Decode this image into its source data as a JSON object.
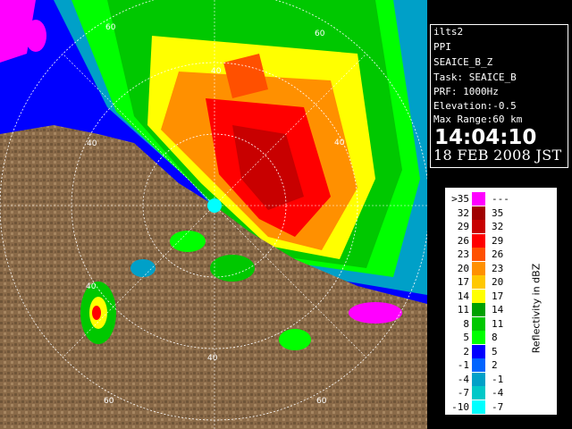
{
  "info": {
    "lines": [
      "ilts2",
      "PPI",
      "SEAICE_B_Z",
      "Task: SEAICE_B",
      "PRF: 1000Hz",
      "Elevation:-0.5",
      "Max Range:60 km"
    ],
    "time": "14:04:10",
    "date": "18 FEB 2008 JST"
  },
  "legend": {
    "title": "Reflectivity in dBZ",
    "rows": [
      {
        "low": ">35",
        "high": "---",
        "color": "#ff00ff"
      },
      {
        "low": "32",
        "high": "35",
        "color": "#a00000"
      },
      {
        "low": "29",
        "high": "32",
        "color": "#c80000"
      },
      {
        "low": "26",
        "high": "29",
        "color": "#ff0000"
      },
      {
        "low": "23",
        "high": "26",
        "color": "#ff5000"
      },
      {
        "low": "20",
        "high": "23",
        "color": "#ff9000"
      },
      {
        "low": "17",
        "high": "20",
        "color": "#ffc800"
      },
      {
        "low": "14",
        "high": "17",
        "color": "#ffff00"
      },
      {
        "low": "11",
        "high": "14",
        "color": "#00a000"
      },
      {
        "low": "8",
        "high": "11",
        "color": "#00c800"
      },
      {
        "low": "5",
        "high": "8",
        "color": "#00ff00"
      },
      {
        "low": "2",
        "high": "5",
        "color": "#0000ff"
      },
      {
        "low": "-1",
        "high": "2",
        "color": "#0064ff"
      },
      {
        "low": "-4",
        "high": "-1",
        "color": "#00a0c8"
      },
      {
        "low": "-7",
        "high": "-4",
        "color": "#00c8c8"
      },
      {
        "low": "-10",
        "high": "-7",
        "color": "#00ffff"
      }
    ]
  },
  "map": {
    "range_ring_labels": [
      "40",
      "60",
      "40",
      "60",
      "40",
      "40",
      "40",
      "60",
      "60"
    ],
    "colors": {
      "sea": "#0000ff",
      "land": "#8a6a48",
      "ring": "#ffffff"
    }
  }
}
